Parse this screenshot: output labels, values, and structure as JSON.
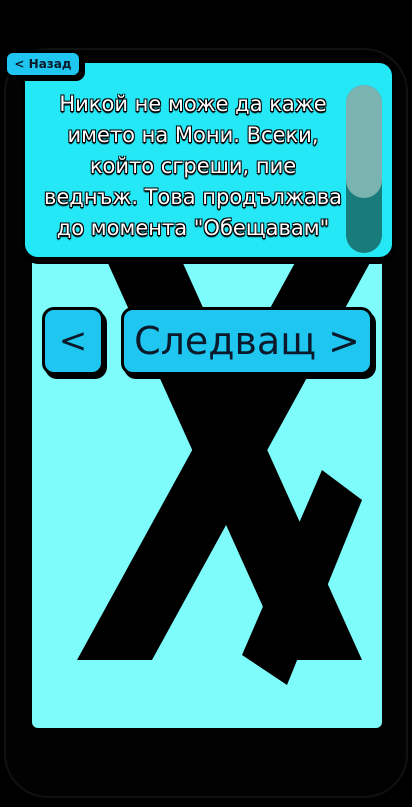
{
  "back_button": {
    "label": "< Назад"
  },
  "card": {
    "text": "Никой не може да каже името на Мони. Всеки, който сгреши, пие веднъж. Това продължава до момента \"Обещавам\"",
    "scroll_position": 0
  },
  "nav": {
    "prev_label": "<",
    "next_label": "Следващ >"
  },
  "background_symbol": "x-icon",
  "colors": {
    "panel": "#7efcfc",
    "card": "#25e8f6",
    "button": "#1fc6f0",
    "scroll_track": "#1a7b7b",
    "scroll_thumb": "#7ab3b0"
  }
}
